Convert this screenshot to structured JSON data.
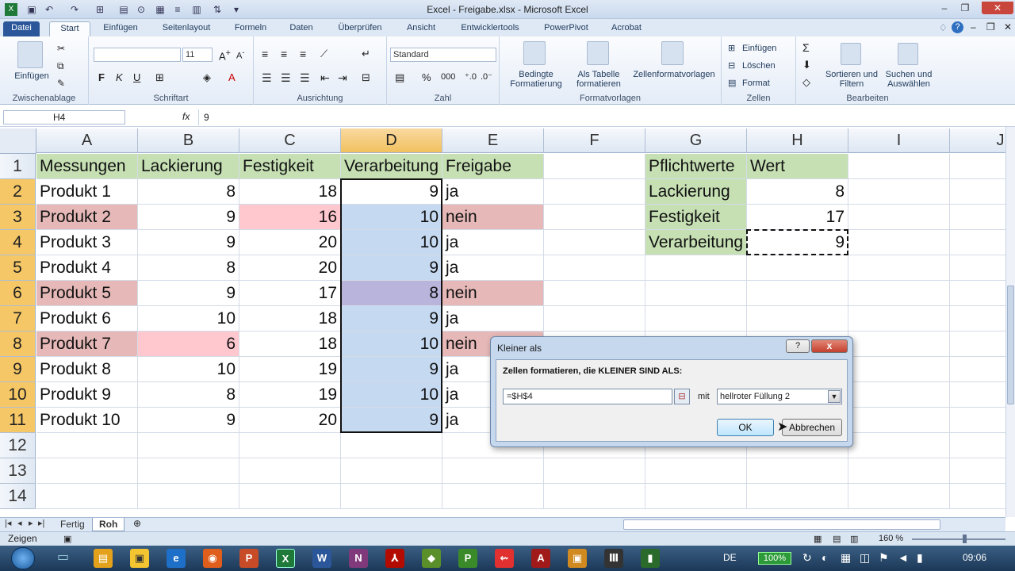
{
  "window": {
    "title": "Excel - Freigabe.xlsx - Microsoft Excel"
  },
  "tabs": [
    "Datei",
    "Start",
    "Einfügen",
    "Seitenlayout",
    "Formeln",
    "Daten",
    "Überprüfen",
    "Ansicht",
    "Entwicklertools",
    "PowerPivot",
    "Acrobat"
  ],
  "ribbon": {
    "clipboard": {
      "paste": "Einfügen",
      "label": "Zwischenablage"
    },
    "font": {
      "size": "11",
      "label": "Schriftart"
    },
    "alignment": {
      "label": "Ausrichtung"
    },
    "number": {
      "format": "Standard",
      "percent": "%",
      "thousands": "000",
      "label": "Zahl"
    },
    "styles": {
      "conditional": "Bedingte Formatierung",
      "as_table": "Als Tabelle formatieren",
      "cell_styles": "Zellenformatvorlagen",
      "label": "Formatvorlagen"
    },
    "cells": {
      "insert": "Einfügen",
      "delete": "Löschen",
      "format": "Format",
      "label": "Zellen"
    },
    "editing": {
      "sort": "Sortieren und Filtern",
      "find": "Suchen und Auswählen",
      "label": "Bearbeiten"
    }
  },
  "formula_bar": {
    "name_box": "H4",
    "fx": "fx",
    "value": "9"
  },
  "columns": [
    "A",
    "B",
    "C",
    "D",
    "E",
    "F",
    "G",
    "H",
    "I",
    "J"
  ],
  "rows": [
    "1",
    "2",
    "3",
    "4",
    "5",
    "6",
    "7",
    "8",
    "9",
    "10",
    "11",
    "12",
    "13",
    "14"
  ],
  "table": {
    "headers": [
      "Messungen",
      "Lackierung",
      "Festigkeit",
      "Verarbeitung",
      "Freigabe"
    ],
    "rows": [
      [
        "Produkt 1",
        "8",
        "18",
        "9",
        "ja"
      ],
      [
        "Produkt 2",
        "9",
        "16",
        "10",
        "nein"
      ],
      [
        "Produkt 3",
        "9",
        "20",
        "10",
        "ja"
      ],
      [
        "Produkt 4",
        "8",
        "20",
        "9",
        "ja"
      ],
      [
        "Produkt 5",
        "9",
        "17",
        "8",
        "nein"
      ],
      [
        "Produkt 6",
        "10",
        "18",
        "9",
        "ja"
      ],
      [
        "Produkt 7",
        "6",
        "18",
        "10",
        "nein"
      ],
      [
        "Produkt 8",
        "10",
        "19",
        "9",
        "ja"
      ],
      [
        "Produkt 9",
        "8",
        "19",
        "10",
        "ja"
      ],
      [
        "Produkt 10",
        "9",
        "20",
        "9",
        "ja"
      ]
    ]
  },
  "requirements": {
    "headers": [
      "Pflichtwerte",
      "Wert"
    ],
    "rows": [
      [
        "Lackierung",
        "8"
      ],
      [
        "Festigkeit",
        "17"
      ],
      [
        "Verarbeitung",
        "9"
      ]
    ]
  },
  "sheets": [
    "Fertig",
    "Roh"
  ],
  "status": {
    "mode": "Zeigen",
    "zoom": "160 %"
  },
  "taskbar": {
    "lang": "DE",
    "battery": "100%",
    "time": "09:06"
  },
  "dialog": {
    "title": "Kleiner als",
    "prompt": "Zellen formatieren, die KLEINER SIND ALS:",
    "value": "=$H$4",
    "mit": "mit",
    "format": "hellroter Füllung 2",
    "ok": "OK",
    "cancel": "Abbrechen",
    "help": "?",
    "close": "x"
  },
  "colors": {
    "green_fill": "#c6e0b4",
    "red_fill": "#e6b9b8",
    "light_red_fill": "#ffc7ce",
    "blue_select": "#c5d9f1"
  }
}
